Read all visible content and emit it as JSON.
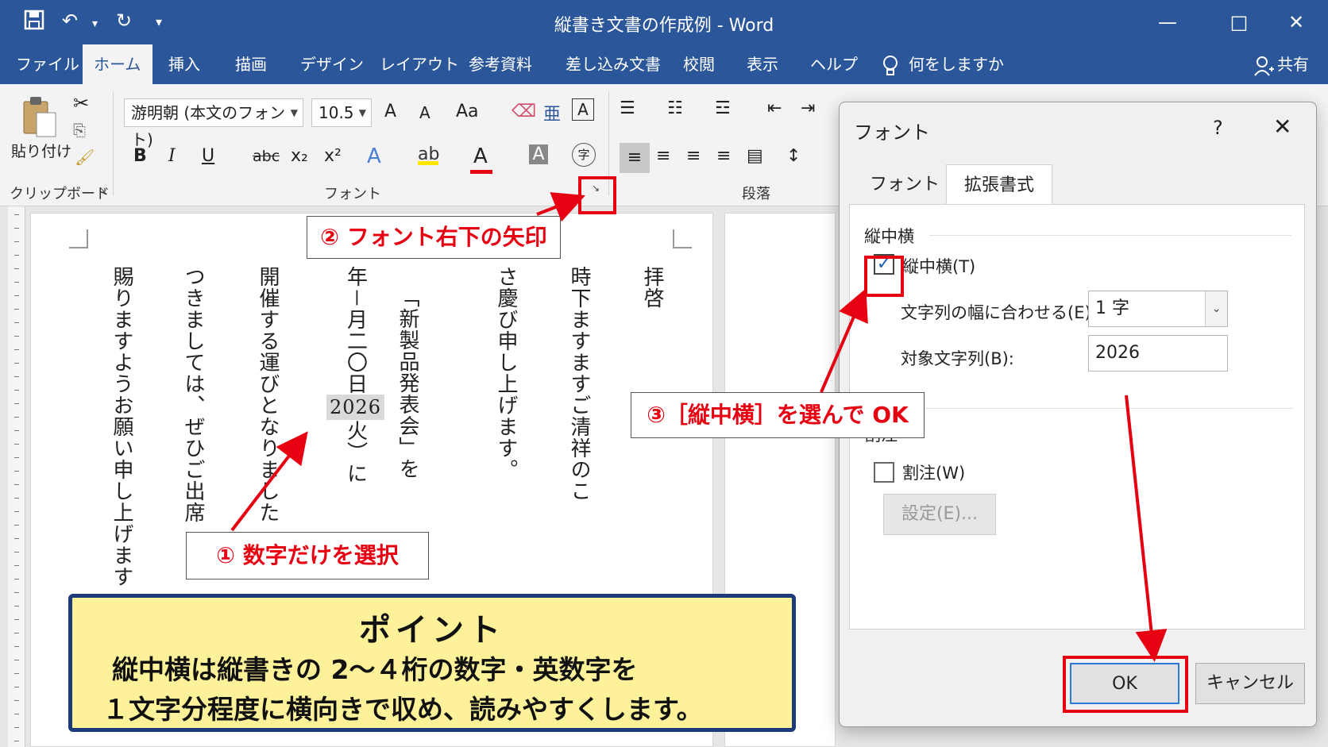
{
  "titlebar": {
    "title": "縦書き文書の作成例 - Word",
    "qa_save_icon": "save-icon",
    "qa_undo_icon": "undo-icon",
    "qa_redo_icon": "redo-icon",
    "minimize": "—",
    "maximize": "□",
    "close": "✕"
  },
  "tabs": [
    "ファイル",
    "ホーム",
    "挿入",
    "描画",
    "デザイン",
    "レイアウト",
    "参考資料",
    "差し込み文書",
    "校閲",
    "表示",
    "ヘルプ"
  ],
  "tell_me": "何をしますか",
  "share": "共有",
  "ribbon": {
    "paste": "貼り付け",
    "clipboard_label": "クリップボード",
    "font_name": "游明朝 (本文のフォント)",
    "font_size": "10.5",
    "font_label": "フォント",
    "paragraph_label": "段落",
    "bold": "B",
    "italic": "I",
    "underline": "U",
    "strike": "abc",
    "subscript": "x₂",
    "superscript": "x²",
    "grow": "A",
    "shrink": "A",
    "case": "Aa",
    "font_color": "A",
    "shade": "A",
    "phonetic": "亜",
    "border_char": "A",
    "enclose": "字"
  },
  "document": {
    "col1": "拝啓",
    "col2": "時下ますますご清祥のこ",
    "col3": "さ慶び申し上げます。",
    "col4": "「新製品発表会」を",
    "col5_pre": "年－月二〇日",
    "col5_sel": "2026",
    "col5_post": "火）に",
    "col6": "開催する運びとなりました",
    "col7": "つきましては、ぜひご出席",
    "col8": "賜りますようお願い申し上げます"
  },
  "dialog": {
    "title": "フォント",
    "help": "?",
    "close": "✕",
    "tab_font": "フォント",
    "tab_advanced": "拡張書式",
    "section_tcy": "縦中横",
    "tcy_checkbox": "縦中横(T)",
    "tcy_checked": true,
    "fit_label": "文字列の幅に合わせる(E):",
    "fit_value": "1 字",
    "target_label": "対象文字列(B):",
    "target_value": "2026",
    "section_warichu": "割注",
    "warichu_checkbox": "割注(W)",
    "settings_button": "設定(E)...",
    "ok": "OK",
    "cancel": "キャンセル"
  },
  "annotations": {
    "step1": "① 数字だけを選択",
    "step2": "② フォント右下の矢印",
    "step3": "③［縦中横］を選んで OK",
    "point_title": "ポイント",
    "point_line1": "縦中横は縦書きの 2～４桁の数字・英数字を",
    "point_line2": "１文字分程度に横向きで収め、読みやすくします。",
    "accent_color": "#e60012",
    "word_blue": "#2b579a"
  }
}
